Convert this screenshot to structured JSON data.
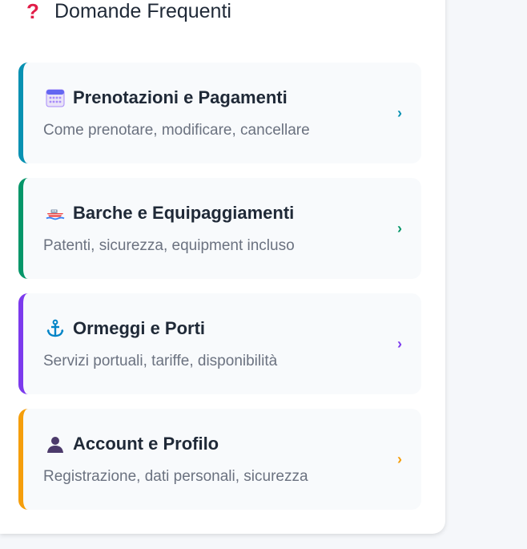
{
  "header": {
    "icon": "question-icon",
    "icon_glyph": "?",
    "title": "Domande Frequenti"
  },
  "items": [
    {
      "icon": "calendar-icon",
      "title": "Prenotazioni e Pagamenti",
      "description": "Come prenotare, modificare, cancellare",
      "accent": "#0891b2",
      "chevron": "›"
    },
    {
      "icon": "boat-icon",
      "title": "Barche e Equipaggiamenti",
      "description": "Patenti, sicurezza, equipment incluso",
      "accent": "#059669",
      "chevron": "›"
    },
    {
      "icon": "anchor-icon",
      "title": "Ormeggi e Porti",
      "description": "Servizi portuali, tariffe, disponibilità",
      "accent": "#7c3aed",
      "chevron": "›"
    },
    {
      "icon": "user-icon",
      "title": "Account e Profilo",
      "description": "Registrazione, dati personali, sicurezza",
      "accent": "#f59e0b",
      "chevron": "›"
    }
  ]
}
